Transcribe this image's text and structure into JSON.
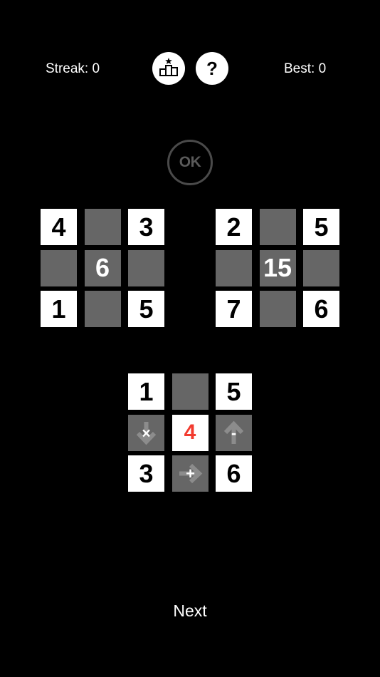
{
  "header": {
    "streak_label": "Streak: 0",
    "best_label": "Best: 0",
    "leaderboard_icon": "podium-star-icon",
    "help_icon_text": "?"
  },
  "ok_button": {
    "label": "OK"
  },
  "puzzle": {
    "left_grid": [
      [
        "4",
        "",
        "3"
      ],
      [
        "",
        "6",
        ""
      ],
      [
        "1",
        "",
        "5"
      ]
    ],
    "right_grid": [
      [
        "2",
        "",
        "5"
      ],
      [
        "",
        "15",
        ""
      ],
      [
        "7",
        "",
        "6"
      ]
    ],
    "player_grid": {
      "top_left": "1",
      "top_right": "5",
      "middle_left_op": "×",
      "center_value": "4",
      "middle_right_op": "-",
      "bottom_left": "3",
      "bottom_middle_op": "+",
      "bottom_right": "6"
    }
  },
  "footer": {
    "next_label": "Next"
  },
  "colors": {
    "background": "#000000",
    "tile": "#ffffff",
    "gray_tile": "#666666",
    "accent_red": "#f23b2f"
  }
}
